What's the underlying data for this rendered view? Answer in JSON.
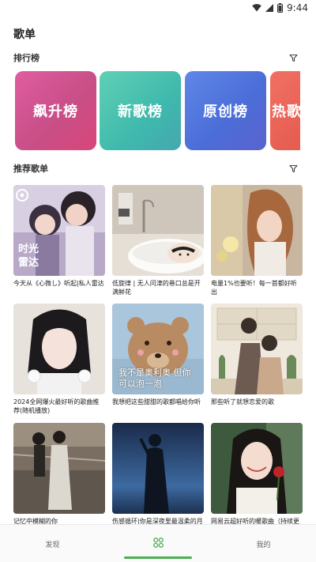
{
  "status_bar": {
    "time": "9:44",
    "icons": [
      "wifi-icon",
      "signal-icon",
      "battery-icon"
    ]
  },
  "page_title": "歌单",
  "rank_section": {
    "title": "排行榜",
    "cards": [
      {
        "label": "飙升榜"
      },
      {
        "label": "新歌榜"
      },
      {
        "label": "原创榜"
      },
      {
        "label": "热歌榜"
      }
    ]
  },
  "recommend_section": {
    "title": "推荐歌单",
    "playlists": [
      {
        "title": "今天从《心微し》听起|私人雷达",
        "cover_text": "时光\n雷达"
      },
      {
        "title": "低旋律 | 无人问津的巷口总是开满鲜花",
        "cover_text": ""
      },
      {
        "title": "电量1%也要听！每一首都好听出",
        "cover_text": ""
      },
      {
        "title": "2024全网爆火最好听的歌曲推荐(随机播放)",
        "cover_text": ""
      },
      {
        "title": "我想把这些甜甜的歌都唱给你听",
        "cover_text": "我不是奥利奥 但你可以泡一泡"
      },
      {
        "title": "那些听了就想恋爱的歌",
        "cover_text": ""
      },
      {
        "title": "记忆中模糊的你",
        "cover_text": ""
      },
      {
        "title": "伤感循环|你是深夜里最温柔的月光",
        "cover_text": ""
      },
      {
        "title": "网易云超好听的暖歌曲（持续更新）",
        "cover_text": ""
      }
    ]
  },
  "bottom_nav": {
    "items": [
      {
        "label": "发现"
      },
      {
        "label": "",
        "icon": "grid-icon"
      },
      {
        "label": "我的"
      }
    ],
    "active_index": 1,
    "accent": "#4caf50"
  }
}
